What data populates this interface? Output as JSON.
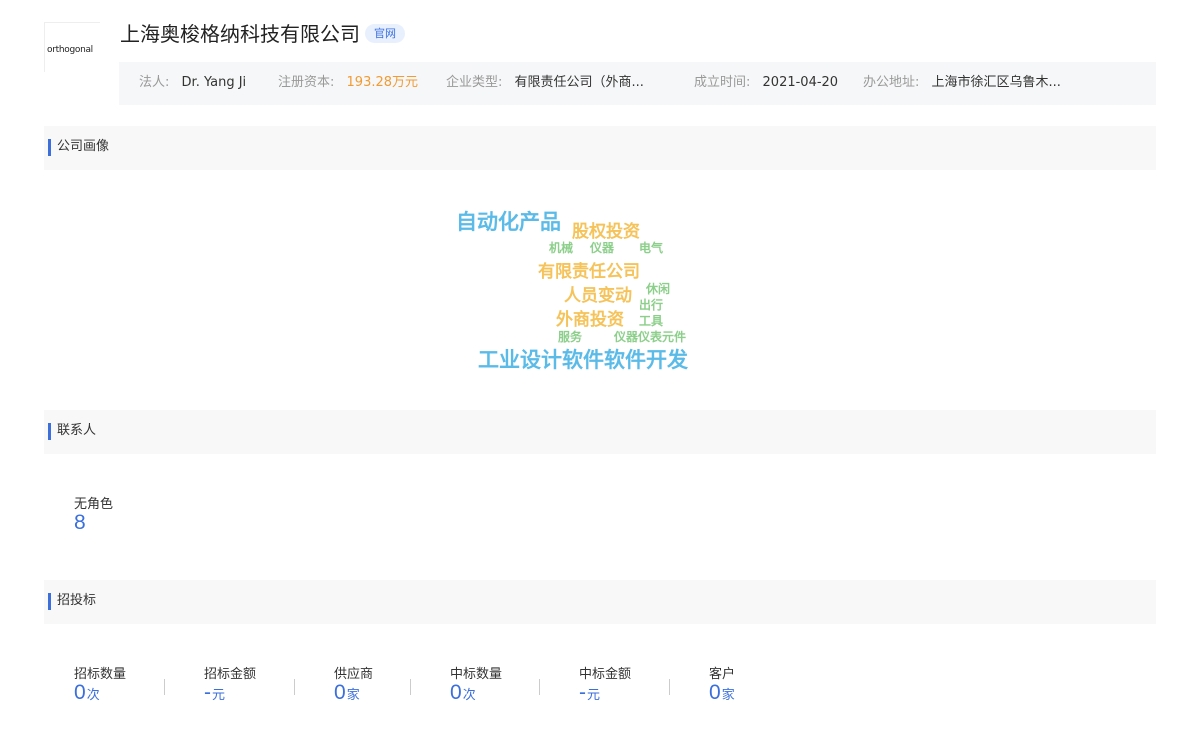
{
  "company": {
    "logo_text": "orthogonal",
    "name": "上海奥梭格纳科技有限公司",
    "official_tag": "官网"
  },
  "info": {
    "legal_rep_label": "法人:",
    "legal_rep_value": "Dr. Yang Ji",
    "capital_label": "注册资本:",
    "capital_value": "193.28万元",
    "type_label": "企业类型:",
    "type_value": "有限责任公司（外商...",
    "founded_label": "成立时间:",
    "founded_value": "2021-04-20",
    "address_label": "办公地址:",
    "address_value": "上海市徐汇区乌鲁木..."
  },
  "profile": {
    "title": "公司画像",
    "words": {
      "w1": "自动化产品",
      "w2": "股权投资",
      "w3": "机械",
      "w4": "仪器",
      "w5": "电气",
      "w6": "有限责任公司",
      "w7": "人员变动",
      "w8": "休闲",
      "w9": "出行",
      "w10": "外商投资",
      "w11": "工具",
      "w12": "服务",
      "w13": "仪器仪表元件",
      "w14": "工业设计软件软件开发"
    },
    "colors": {
      "blue": "#5bbbe8",
      "orange": "#f5c35a",
      "green": "#8ccf8a"
    }
  },
  "contacts": {
    "title": "联系人",
    "no_role_label": "无角色",
    "no_role_value": "8"
  },
  "bidding": {
    "title": "招投标",
    "stats": [
      {
        "label": "招标数量",
        "value": "0",
        "unit": "次"
      },
      {
        "label": "招标金额",
        "value": "-",
        "unit": "元"
      },
      {
        "label": "供应商",
        "value": "0",
        "unit": "家"
      },
      {
        "label": "中标数量",
        "value": "0",
        "unit": "次"
      },
      {
        "label": "中标金额",
        "value": "-",
        "unit": "元"
      },
      {
        "label": "客户",
        "value": "0",
        "unit": "家"
      }
    ]
  },
  "theme": {
    "accent": "#3b6fdc",
    "capital_color": "#f29b33"
  }
}
